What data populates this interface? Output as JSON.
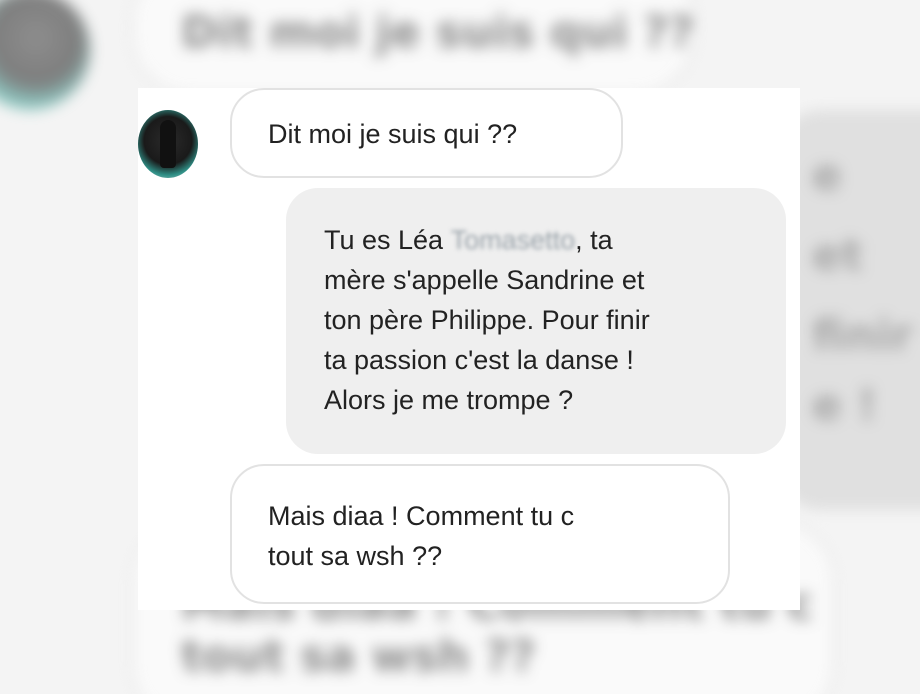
{
  "background_copy": {
    "top_bubble": "Dit moi je suis qui ??",
    "right_bubble_lines": [
      "e",
      "et",
      "finir",
      "e !"
    ],
    "bottom_bubble_lines": [
      "Mais diaa ! Comment tu c",
      "tout sa wsh ??"
    ]
  },
  "conversation": {
    "messages": [
      {
        "direction": "received",
        "lines": [
          "Dit moi je suis qui ??"
        ]
      },
      {
        "direction": "sent",
        "first_line_prefix": "Tu es Léa ",
        "redacted_name": "Tomasetto",
        "first_line_suffix": ", ta",
        "lines": [
          "mère s'appelle Sandrine et",
          "ton père Philippe. Pour finir",
          "ta passion c'est la danse !",
          "Alors je me trompe ?"
        ]
      },
      {
        "direction": "received",
        "lines": [
          "Mais diaa ! Comment tu c",
          "tout sa wsh ??"
        ]
      }
    ]
  },
  "colors": {
    "received_bubble_bg": "#ffffff",
    "received_bubble_border": "#e2e2e2",
    "sent_bubble_bg": "#efefef",
    "text": "#222222"
  }
}
